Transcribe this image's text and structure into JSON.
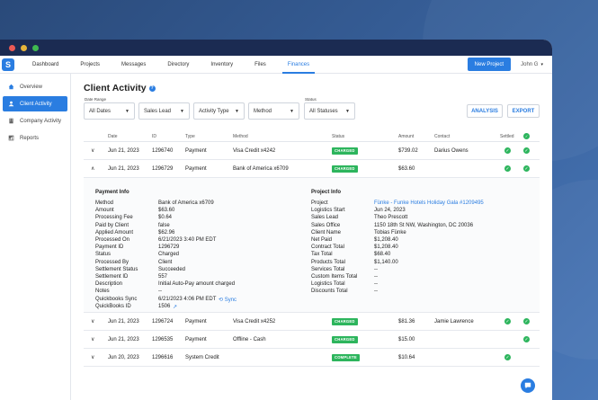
{
  "colors": {
    "accent": "#2a7de1",
    "dark": "#1b2b52",
    "green": "#2db55d",
    "charged": "#2db55d",
    "complete": "#2db55d"
  },
  "nav": {
    "items": [
      "Dashboard",
      "Projects",
      "Messages",
      "Directory",
      "Inventory",
      "Files",
      "Finances"
    ],
    "active": "Finances",
    "new_project": "New Project",
    "user": "John G"
  },
  "sidebar": {
    "items": [
      {
        "label": "Overview",
        "icon": "home-icon"
      },
      {
        "label": "Client Activity",
        "icon": "person-icon"
      },
      {
        "label": "Company Activity",
        "icon": "building-icon"
      },
      {
        "label": "Reports",
        "icon": "chart-icon"
      }
    ],
    "active": "Client Activity"
  },
  "page": {
    "title": "Client Activity"
  },
  "filters": {
    "date_range_label": "Date Range",
    "date_range_value": "All Dates",
    "sales_lead": "Sales Lead",
    "activity_type": "Activity Type",
    "method": "Method",
    "status_label": "Status",
    "status_value": "All Statuses"
  },
  "actions": {
    "analysis": "ANALYSIS",
    "export": "EXPORT"
  },
  "table": {
    "headers": {
      "date": "Date",
      "id": "ID",
      "type": "Type",
      "method": "Method",
      "status": "Status",
      "amount": "Amount",
      "contact": "Contact",
      "settled": "Settled"
    },
    "rows": [
      {
        "date": "Jun 21, 2023",
        "id": "1296740",
        "type": "Payment",
        "method": "Visa Credit x4242",
        "status": "CHARGED",
        "amount": "$739.02",
        "contact": "Darius Owens",
        "settled": true,
        "extra": true
      },
      {
        "date": "Jun 21, 2023",
        "id": "1296729",
        "type": "Payment",
        "method": "Bank of America x6709",
        "status": "CHARGED",
        "amount": "$63.60",
        "contact": "",
        "settled": true,
        "extra": true
      }
    ],
    "rows_after": [
      {
        "date": "Jun 21, 2023",
        "id": "1296724",
        "type": "Payment",
        "method": "Visa Credit x4252",
        "status": "CHARGED",
        "amount": "$81.36",
        "contact": "Jamie Lawrence",
        "settled": true,
        "extra": true
      },
      {
        "date": "Jun 21, 2023",
        "id": "1296535",
        "type": "Payment",
        "method": "Offline - Cash",
        "status": "CHARGED",
        "amount": "$15.00",
        "contact": "",
        "settled": false,
        "extra": true
      },
      {
        "date": "Jun 20, 2023",
        "id": "1296616",
        "type": "System Credit",
        "method": "",
        "status": "COMPLETE",
        "amount": "$10.64",
        "contact": "",
        "settled": true,
        "extra": false
      }
    ]
  },
  "payment_info": {
    "title": "Payment Info",
    "fields": [
      {
        "k": "Method",
        "v": "Bank of America x6709"
      },
      {
        "k": "Amount",
        "v": "$63.60"
      },
      {
        "k": "Processing Fee",
        "v": "$0.64"
      },
      {
        "k": "Paid by Client",
        "v": "false"
      },
      {
        "k": "Applied Amount",
        "v": "$62.96"
      },
      {
        "k": "Processed On",
        "v": "6/21/2023 3:40 PM EDT"
      },
      {
        "k": "Payment ID",
        "v": "1296729"
      },
      {
        "k": "Status",
        "v": "Charged"
      },
      {
        "k": "Processed By",
        "v": "Client"
      },
      {
        "k": "Settlement Status",
        "v": "Succeeded"
      },
      {
        "k": "Settlement ID",
        "v": "557"
      },
      {
        "k": "Description",
        "v": "Initial Auto-Pay amount charged"
      },
      {
        "k": "Notes",
        "v": "--"
      },
      {
        "k": "Quickbooks Sync",
        "v": "6/21/2023 4:06 PM EDT"
      },
      {
        "k": "QuickBooks ID",
        "v": "1506"
      }
    ],
    "sync_label": "Sync"
  },
  "project_info": {
    "title": "Project Info",
    "fields": [
      {
        "k": "Project",
        "v": "Fünke - Funke Hotels Holiday Gala #1209495"
      },
      {
        "k": "Logistics Start",
        "v": "Jun 24, 2023"
      },
      {
        "k": "Sales Lead",
        "v": "Theo Prescott"
      },
      {
        "k": "Sales Office",
        "v": "1150 18th St NW, Washington, DC 20036"
      },
      {
        "k": "Client Name",
        "v": "Tobias Fünke"
      },
      {
        "k": "Net Paid",
        "v": "$1,208.40"
      },
      {
        "k": "Contract Total",
        "v": "$1,208.40"
      },
      {
        "k": "Tax Total",
        "v": "$68.40"
      },
      {
        "k": "Products Total",
        "v": "$1,140.00"
      },
      {
        "k": "Services Total",
        "v": "--"
      },
      {
        "k": "Custom Items Total",
        "v": "--"
      },
      {
        "k": "Logistics Total",
        "v": "--"
      },
      {
        "k": "Discounts Total",
        "v": "--"
      }
    ]
  }
}
